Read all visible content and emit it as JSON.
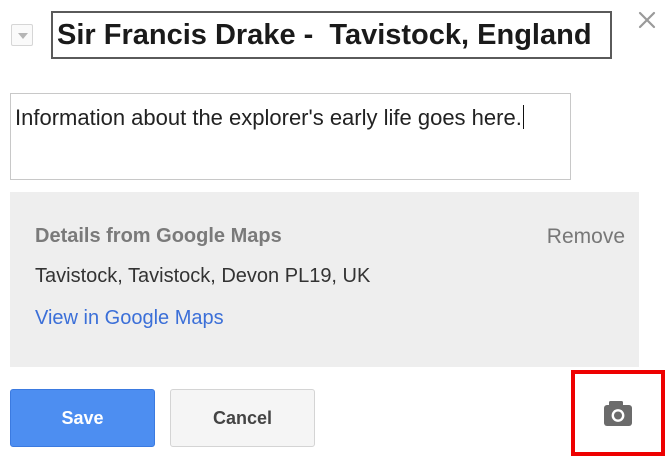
{
  "header": {
    "title_value": "Sir Francis Drake -  Tavistock, England",
    "icons": {
      "style_toggle": "chevron-down-icon",
      "close": "close-icon"
    }
  },
  "description": {
    "value": "Information about the explorer's early life goes here."
  },
  "details": {
    "heading": "Details from Google Maps",
    "remove_label": "Remove",
    "address": "Tavistock, Tavistock, Devon PL19, UK",
    "maps_link": "View in Google Maps"
  },
  "actions": {
    "save_label": "Save",
    "cancel_label": "Cancel",
    "photo_icon": "camera-icon"
  },
  "colors": {
    "save_button": "#4d8ef1",
    "link": "#3b6fd8",
    "details_background": "#eeeeee",
    "highlight": "#ee0000"
  }
}
